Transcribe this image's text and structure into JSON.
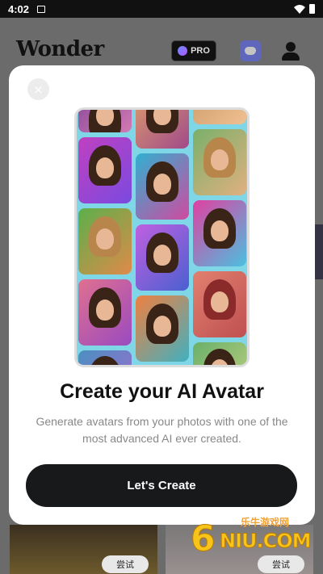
{
  "status_bar": {
    "time": "4:02",
    "icons": [
      "image-icon",
      "wifi-icon",
      "battery-icon"
    ]
  },
  "app": {
    "logo": "Wonder",
    "pro_label": "PRO",
    "try_labels": [
      "尝试",
      "尝试"
    ]
  },
  "modal": {
    "title": "Create your AI Avatar",
    "description": "Generate avatars from your photos with one of the most advanced AI ever created.",
    "cta_label": "Let's Create",
    "close_icon": "×"
  },
  "watermark": {
    "digit": "6",
    "text": "NIU.COM",
    "cn": "乐牛游戏网"
  },
  "colors": {
    "cta_bg": "#18191a",
    "modal_bg": "#ffffff",
    "overlay": "#6b6b6b",
    "discord": "#5865f2"
  }
}
